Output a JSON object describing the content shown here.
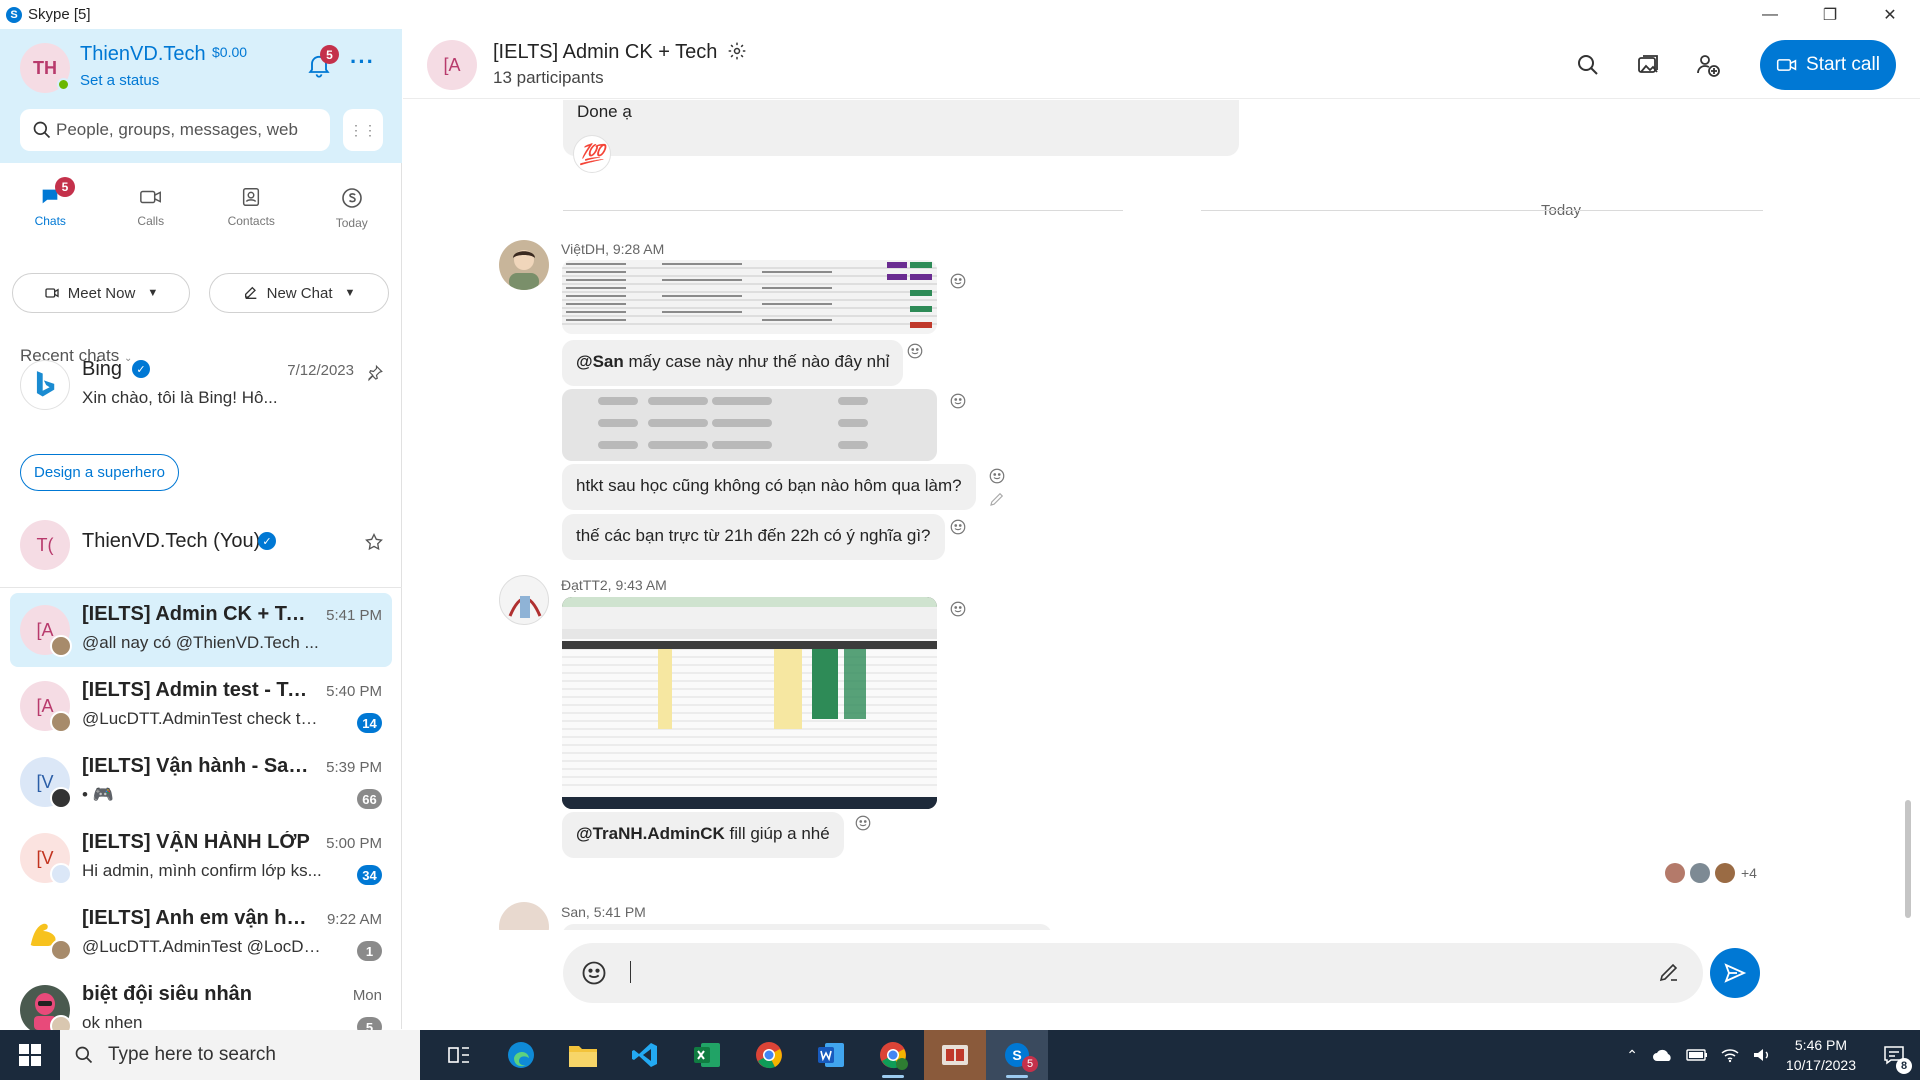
{
  "window": {
    "title": "Skype [5]"
  },
  "profile": {
    "initials": "TH",
    "name": "ThienVD.Tech",
    "balance": "$0.00",
    "status": "Set a status",
    "notification_count": "5"
  },
  "search": {
    "placeholder": "People, groups, messages, web"
  },
  "nav": {
    "tabs": [
      {
        "label": "Chats",
        "badge": "5"
      },
      {
        "label": "Calls"
      },
      {
        "label": "Contacts"
      },
      {
        "label": "Today"
      }
    ]
  },
  "actions": {
    "meet_now": "Meet Now",
    "new_chat": "New Chat"
  },
  "recent_chats_label": "Recent chats",
  "pinned": [
    {
      "title": "Bing",
      "preview": "Xin chào, tôi là Bing! Hô...",
      "time": "7/12/2023",
      "suggestion": "Design a superhero"
    },
    {
      "initials": "T(",
      "title": "ThienVD.Tech (You)"
    }
  ],
  "chats": [
    {
      "initials": "[A",
      "title": "[IELTS] Admin CK + Tech",
      "preview": "@all nay có @ThienVD.Tech ...",
      "time": "5:41 PM",
      "count": ""
    },
    {
      "initials": "[A",
      "title": "[IELTS] Admin test - Te...",
      "preview": "@LucDTT.AdminTest check tạ...",
      "time": "5:40 PM",
      "count": "14"
    },
    {
      "initials": "[V",
      "title": "[IELTS] Vận hành - Sales",
      "preview": "• 🎮",
      "time": "5:39 PM",
      "count": "66"
    },
    {
      "initials": "[V",
      "title": "[IELTS] VẬN HÀNH LỚP",
      "preview": "Hi admin, mình confirm lớp ks...",
      "time": "5:00 PM",
      "count": "34"
    },
    {
      "initials": "",
      "title": "[IELTS] Anh em vận hà...",
      "preview": "@LucDTT.AdminTest @LocDD...",
      "time": "9:22 AM",
      "count": "1"
    },
    {
      "initials": "",
      "title": "biệt đội siêu nhân",
      "preview": "ok nhen",
      "time": "Mon",
      "count": "5"
    }
  ],
  "conversation": {
    "initials": "[A",
    "title": "[IELTS] Admin CK + Tech",
    "participants": "13 participants",
    "start_call": "Start call",
    "day_separator": "Today",
    "messages": [
      {
        "text": "Done ạ",
        "reaction": "💯"
      },
      {
        "sender": "ViệtDH, 9:28 AM"
      },
      {
        "mention": "@San",
        "text": " mấy case này như thế nào đây nhỉ"
      },
      {
        "text": "htkt sau học cũng không có bạn nào hôm qua làm?"
      },
      {
        "text": "thế các bạn trực từ 21h đến 22h có ý nghĩa gì?"
      },
      {
        "sender": "ĐạtTT2, 9:43 AM"
      },
      {
        "mention": "@TraNH.AdminCK",
        "text": " fill giúp a nhé"
      },
      {
        "sender": "San, 5:41 PM"
      }
    ],
    "read_more": "+4"
  },
  "compose": {
    "placeholder": ""
  },
  "taskbar": {
    "search_placeholder": "Type here to search",
    "time": "5:46 PM",
    "date": "10/17/2023",
    "skype_badge": "5",
    "notifications": "8"
  },
  "colors": {
    "accent": "#0078d4",
    "badge_red": "#c4314b",
    "profile_bg": "#d9f0fb",
    "taskbar": "#1b2a3c"
  }
}
